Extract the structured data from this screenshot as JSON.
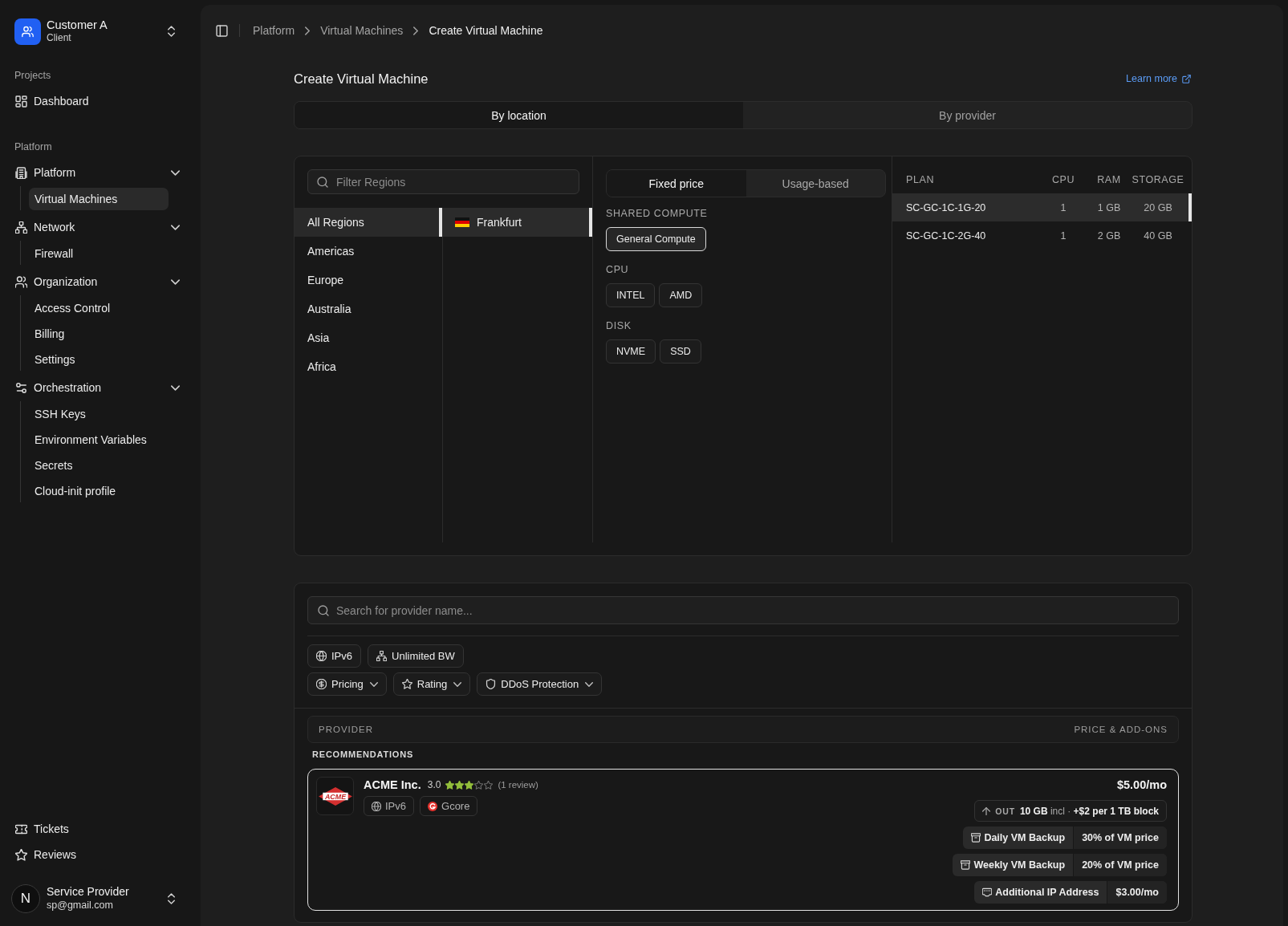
{
  "sidebar": {
    "account": {
      "name": "Customer A",
      "role": "Client"
    },
    "sections": [
      {
        "title": "Projects",
        "items": [
          {
            "label": "Dashboard",
            "selected": false
          }
        ]
      },
      {
        "title": "Platform",
        "items": [
          {
            "label": "Platform",
            "expanded": true,
            "children": [
              {
                "label": "Virtual Machines",
                "selected": true
              }
            ]
          },
          {
            "label": "Network",
            "expanded": true,
            "children": [
              {
                "label": "Firewall",
                "selected": false
              }
            ]
          },
          {
            "label": "Organization",
            "expanded": true,
            "children": [
              {
                "label": "Access Control",
                "selected": false
              },
              {
                "label": "Billing",
                "selected": false
              },
              {
                "label": "Settings",
                "selected": false
              }
            ]
          },
          {
            "label": "Orchestration",
            "expanded": true,
            "children": [
              {
                "label": "SSH Keys",
                "selected": false
              },
              {
                "label": "Environment Variables",
                "selected": false
              },
              {
                "label": "Secrets",
                "selected": false
              },
              {
                "label": "Cloud-init profile",
                "selected": false
              }
            ]
          }
        ]
      }
    ],
    "footer_items": [
      {
        "label": "Tickets",
        "selected": false
      },
      {
        "label": "Reviews",
        "selected": false
      }
    ],
    "user": {
      "avatar": "N",
      "name": "Service Provider",
      "email": "sp@gmail.com"
    }
  },
  "breadcrumb": [
    "Platform",
    "Virtual Machines",
    "Create Virtual Machine"
  ],
  "page": {
    "title": "Create Virtual Machine",
    "link": "Learn more"
  },
  "view_tabs": [
    {
      "label": "By location",
      "selected": true
    },
    {
      "label": "By provider",
      "selected": false
    }
  ],
  "location_panel": {
    "filter": {
      "placeholder": "Filter Regions"
    },
    "regions": [
      {
        "label": "All Regions",
        "selected": true
      },
      {
        "label": "Americas",
        "selected": false
      },
      {
        "label": "Europe",
        "selected": false
      },
      {
        "label": "Australia",
        "selected": false
      },
      {
        "label": "Asia",
        "selected": false
      },
      {
        "label": "Africa",
        "selected": false
      }
    ],
    "cities": [
      {
        "label": "Frankfurt",
        "selected": true
      }
    ],
    "pricing_tabs": [
      {
        "label": "Fixed price",
        "selected": true
      },
      {
        "label": "Usage-based",
        "selected": false
      }
    ],
    "filter_groups": [
      {
        "title": "SHARED COMPUTE",
        "options": [
          {
            "label": "General Compute",
            "selected": true
          }
        ]
      },
      {
        "title": "CPU",
        "options": [
          {
            "label": "INTEL",
            "selected": false
          },
          {
            "label": "AMD",
            "selected": false
          }
        ]
      },
      {
        "title": "DISK",
        "options": [
          {
            "label": "NVME",
            "selected": false
          },
          {
            "label": "SSD",
            "selected": false
          }
        ]
      }
    ],
    "plans": {
      "columns": [
        "PLAN",
        "CPU",
        "RAM",
        "STORAGE"
      ],
      "rows": [
        {
          "cells": [
            "SC-GC-1C-1G-20",
            "1",
            "1 GB",
            "20 GB"
          ],
          "selected": true
        },
        {
          "cells": [
            "SC-GC-1C-2G-40",
            "1",
            "2 GB",
            "40 GB"
          ],
          "selected": false
        }
      ]
    }
  },
  "provider_panel": {
    "search": {
      "placeholder": "Search for provider name..."
    },
    "feature_filters": [
      {
        "label": "IPv6"
      },
      {
        "label": "Unlimited BW"
      }
    ],
    "dropdown_filters": [
      {
        "label": "Pricing"
      },
      {
        "label": "Rating"
      },
      {
        "label": "DDoS Protection"
      }
    ],
    "table": {
      "columns": [
        "PROVIDER",
        "PRICE & ADD-ONS"
      ]
    },
    "groups": [
      {
        "title": "RECOMMENDATIONS",
        "providers": [
          {
            "name": "ACME Inc.",
            "logo_text": "ACME",
            "rating": "3.0",
            "stars": 3,
            "reviews": "(1 review)",
            "tags": [
              {
                "label": "IPv6"
              },
              {
                "label": "Gcore"
              }
            ],
            "price": "$5.00/mo",
            "egress": {
              "direction": "OUT",
              "text": "**10 GB** incl · **+$2 per 1 TB block**"
            },
            "addons": [
              {
                "kind": "backup",
                "name": "Daily VM Backup",
                "price": "30% of VM price"
              },
              {
                "kind": "backup",
                "name": "Weekly VM Backup",
                "price": "20% of VM price"
              },
              {
                "kind": "ip",
                "name": "Additional IP Address",
                "price": "$3.00/mo"
              }
            ],
            "selected": true
          }
        ]
      }
    ]
  }
}
